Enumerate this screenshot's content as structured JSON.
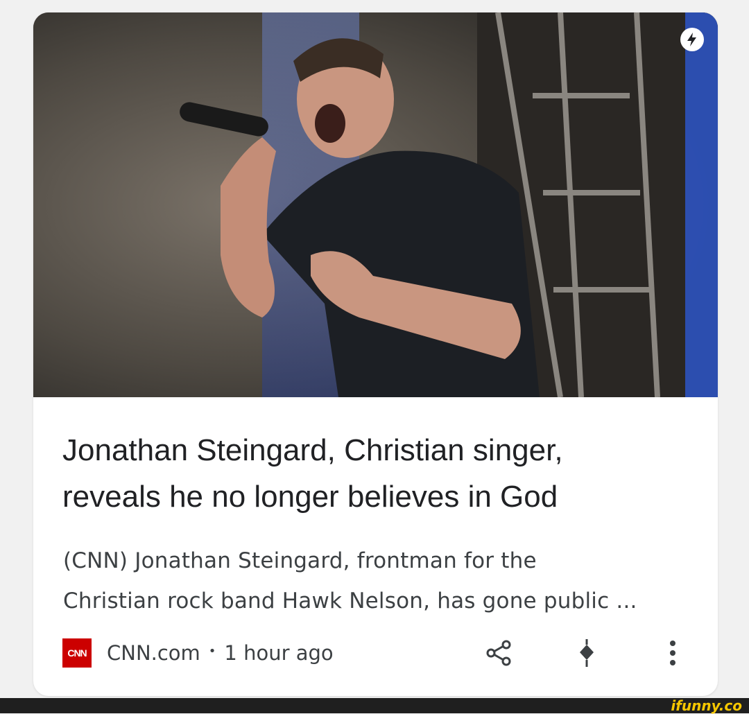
{
  "article": {
    "headline_line1": "Jonathan Steingard, Christian singer,",
    "headline_line2": "reveals he no longer believes in God",
    "snippet_line1": "(CNN) Jonathan Steingard, frontman for the",
    "snippet_line2": "Christian rock band Hawk Nelson, has gone public ...",
    "source_logo_text": "CNN",
    "source": "CNN.com",
    "separator": "•",
    "time": "1 hour ago",
    "image_icon": "amp-lightning-icon"
  },
  "actions": [
    {
      "name": "share-icon"
    },
    {
      "name": "pin-icon"
    },
    {
      "name": "more-vert-icon"
    }
  ],
  "watermark": {
    "text": "ifunny.co"
  },
  "colors": {
    "source_logo_bg": "#cc0000",
    "headline": "#202124",
    "snippet": "#3c4043",
    "watermark": "#f6c700"
  }
}
